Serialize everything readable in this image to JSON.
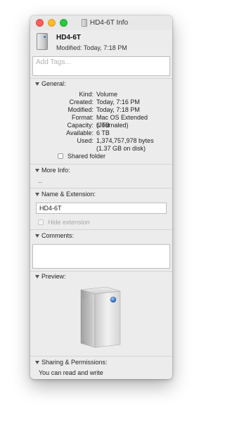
{
  "window": {
    "title": "HD4-6T Info"
  },
  "header": {
    "name": "HD4-6T",
    "modified": "Modified: Today, 7:18 PM"
  },
  "tags": {
    "placeholder": "Add Tags..."
  },
  "general": {
    "label": "General:",
    "rows": [
      {
        "key": "Kind:",
        "value": "Volume"
      },
      {
        "key": "Created:",
        "value": "Today, 7:16 PM"
      },
      {
        "key": "Modified:",
        "value": "Today, 7:18 PM"
      },
      {
        "key": "Format:",
        "value": "Mac OS Extended (Journaled)"
      },
      {
        "key": "Capacity:",
        "value": "6 TB"
      },
      {
        "key": "Available:",
        "value": "6 TB"
      },
      {
        "key": "Used:",
        "value": "1,374,757,978 bytes (1.37 GB on disk)"
      }
    ],
    "shared_folder_label": "Shared folder",
    "shared_folder_checked": false
  },
  "more_info": {
    "label": "More Info:",
    "value": "--"
  },
  "name_extension": {
    "label": "Name & Extension:",
    "value": "HD4-6T",
    "hide_extension_label": "Hide extension",
    "hide_extension_checked": false
  },
  "comments": {
    "label": "Comments:",
    "value": ""
  },
  "preview": {
    "label": "Preview:"
  },
  "sharing": {
    "label": "Sharing & Permissions:",
    "value": "You can read and write"
  },
  "colors": {
    "close": "#fd5f57",
    "minimize": "#febc2e",
    "maximize": "#28c840",
    "accent": "#3d7bd6"
  },
  "icons": {
    "drive": "external-drive-icon",
    "disclosure": "disclosure-triangle-icon"
  }
}
